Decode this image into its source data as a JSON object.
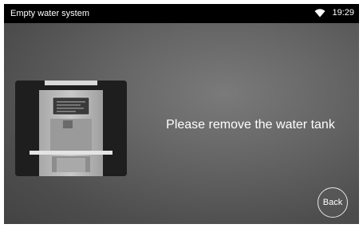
{
  "statusbar": {
    "title": "Empty water system",
    "time": "19:29",
    "wifi_icon": "wifi-icon"
  },
  "main": {
    "illustration": "coffee-machine-illustration",
    "message": "Please remove the water tank",
    "back_label": "Back"
  },
  "colors": {
    "statusbar_bg": "#000000",
    "background": "#5a5a5a",
    "text": "#ffffff"
  }
}
